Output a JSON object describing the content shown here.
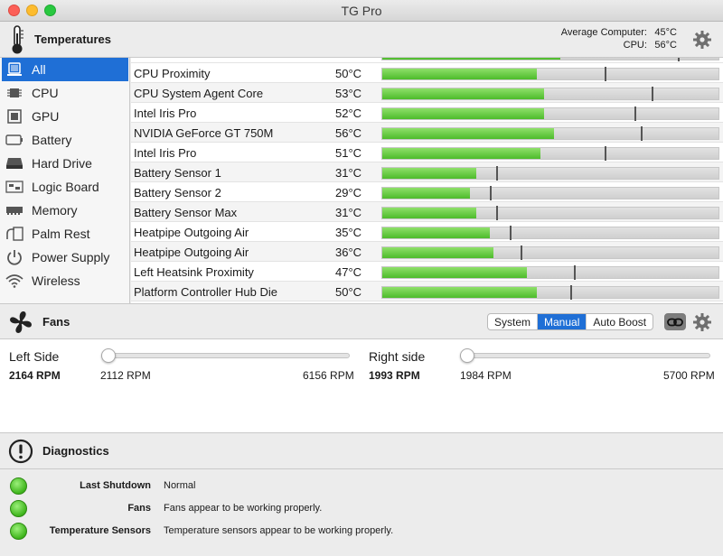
{
  "window": {
    "title": "TG Pro"
  },
  "temperatures": {
    "title": "Temperatures",
    "average_label": "Average Computer:",
    "average_value": "45°C",
    "cpu_label": "CPU:",
    "cpu_value": "56°C",
    "settings_icon": "gear-icon",
    "header_icon": "thermometer-icon"
  },
  "sidebar": {
    "items": [
      {
        "label": "All",
        "icon": "all-sensors-icon",
        "selected": true
      },
      {
        "label": "CPU",
        "icon": "cpu-chip-icon"
      },
      {
        "label": "GPU",
        "icon": "gpu-icon"
      },
      {
        "label": "Battery",
        "icon": "battery-icon"
      },
      {
        "label": "Hard Drive",
        "icon": "hard-drive-icon"
      },
      {
        "label": "Logic Board",
        "icon": "logic-board-icon"
      },
      {
        "label": "Memory",
        "icon": "memory-icon"
      },
      {
        "label": "Palm Rest",
        "icon": "palm-rest-icon"
      },
      {
        "label": "Power Supply",
        "icon": "power-icon"
      },
      {
        "label": "Wireless",
        "icon": "wifi-icon"
      }
    ]
  },
  "sensors": {
    "rows": [
      {
        "name": "CPU Proximity",
        "value": "50°C",
        "fill": 0.46,
        "mark": 0.66
      },
      {
        "name": "CPU System Agent Core",
        "value": "53°C",
        "fill": 0.48,
        "mark": 0.8
      },
      {
        "name": "Intel Iris Pro",
        "value": "52°C",
        "fill": 0.48,
        "mark": 0.75
      },
      {
        "name": "NVIDIA GeForce GT 750M",
        "value": "56°C",
        "fill": 0.51,
        "mark": 0.77
      },
      {
        "name": "Intel Iris Pro",
        "value": "51°C",
        "fill": 0.47,
        "mark": 0.66
      },
      {
        "name": "Battery Sensor 1",
        "value": "31°C",
        "fill": 0.28,
        "mark": 0.34
      },
      {
        "name": "Battery Sensor 2",
        "value": "29°C",
        "fill": 0.26,
        "mark": 0.32
      },
      {
        "name": "Battery Sensor Max",
        "value": "31°C",
        "fill": 0.28,
        "mark": 0.34
      },
      {
        "name": "Heatpipe Outgoing Air",
        "value": "35°C",
        "fill": 0.32,
        "mark": 0.38
      },
      {
        "name": "Heatpipe Outgoing Air",
        "value": "36°C",
        "fill": 0.33,
        "mark": 0.41
      },
      {
        "name": "Left Heatsink Proximity",
        "value": "47°C",
        "fill": 0.43,
        "mark": 0.57
      },
      {
        "name": "Platform Controller Hub Die",
        "value": "50°C",
        "fill": 0.46,
        "mark": 0.56
      }
    ]
  },
  "fans": {
    "title": "Fans",
    "header_icon": "fan-icon",
    "modes": [
      "System",
      "Manual",
      "Auto Boost"
    ],
    "selected_mode": "Manual",
    "link_icon": "link-icon",
    "settings_icon": "gear-icon",
    "left": {
      "label": "Left Side",
      "rpm": "2164 RPM",
      "min": "2112 RPM",
      "max": "6156 RPM",
      "level": 0.0
    },
    "right": {
      "label": "Right side",
      "rpm": "1993 RPM",
      "min": "1984 RPM",
      "max": "5700 RPM",
      "level": 0.0
    }
  },
  "diagnostics": {
    "title": "Diagnostics",
    "header_icon": "warning-icon",
    "rows": [
      {
        "label": "Last Shutdown",
        "value": "Normal",
        "status": "green"
      },
      {
        "label": "Fans",
        "value": "Fans appear to be working properly.",
        "status": "green"
      },
      {
        "label": "Temperature Sensors",
        "value": "Temperature sensors appear to be working properly.",
        "status": "green"
      }
    ]
  },
  "colors": {
    "accent": "#1f6fd6",
    "bar_green": "#4dbb2b",
    "status_green": "#3fb51c"
  }
}
